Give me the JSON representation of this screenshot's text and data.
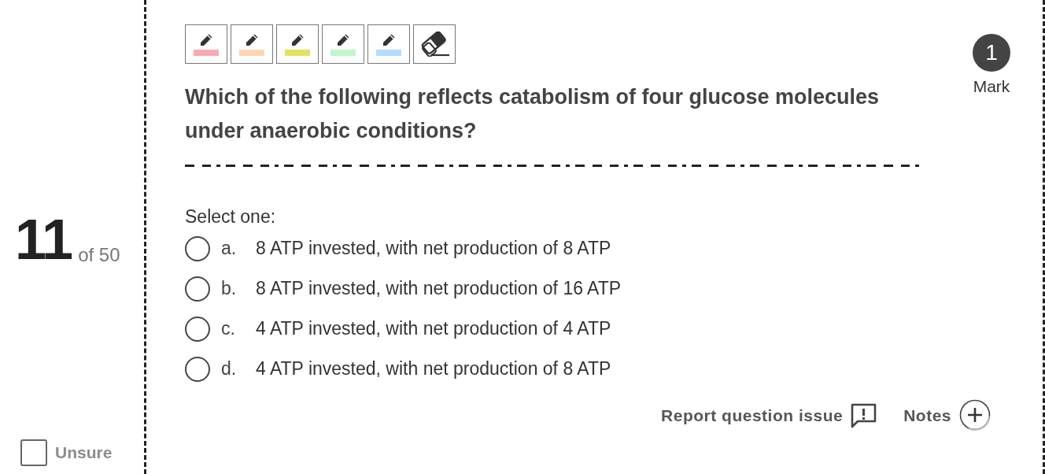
{
  "question_header": {
    "number": "11",
    "total": "of 50"
  },
  "unsure": {
    "label": "Unsure",
    "checked": false
  },
  "highlighter_tools": [
    {
      "kind": "highlighter",
      "color": "#f7aab3"
    },
    {
      "kind": "highlighter",
      "color": "#fbd5b3"
    },
    {
      "kind": "highlighter",
      "color": "#e3e25e"
    },
    {
      "kind": "highlighter",
      "color": "#bff7c9"
    },
    {
      "kind": "highlighter",
      "color": "#b5dcfb"
    },
    {
      "kind": "eraser"
    }
  ],
  "mark": {
    "number": "1",
    "label": "Mark"
  },
  "question": {
    "text": "Which of the following reflects catabolism of four glucose molecules under anaerobic conditions?",
    "prompt": "Select one:",
    "options": [
      {
        "letter": "a.",
        "text": "8 ATP invested, with net production of 8 ATP",
        "selected": false
      },
      {
        "letter": "b.",
        "text": "8 ATP invested, with net production of 16 ATP",
        "selected": false
      },
      {
        "letter": "c.",
        "text": "4 ATP invested, with net production of 4 ATP",
        "selected": false
      },
      {
        "letter": "d.",
        "text": "4 ATP invested, with net production of 8 ATP",
        "selected": false
      }
    ]
  },
  "footer": {
    "report": "Report question issue",
    "notes": "Notes"
  }
}
